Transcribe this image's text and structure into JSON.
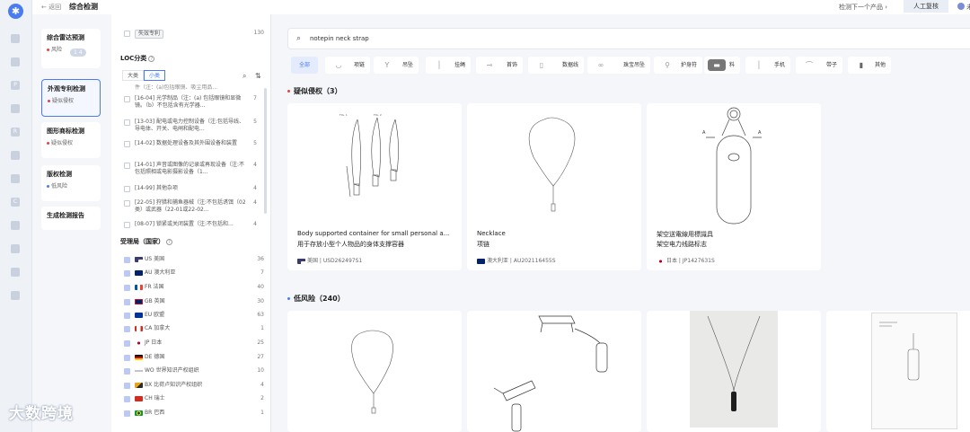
{
  "topbar": {
    "back": "← 返回",
    "title": "综合检测",
    "next_product": "检测下一个产品 ›",
    "manual": "人工复核",
    "user": "未"
  },
  "nav": [
    {
      "title": "综合雷达预测",
      "sub": "风险",
      "badge": "1 4"
    },
    {
      "title": "外观专利检测",
      "sub": "疑似侵权"
    },
    {
      "title": "图形商标检测",
      "sub": "疑似侵权"
    },
    {
      "title": "版权检测",
      "sub": "低风险"
    },
    {
      "title": "生成检测报告",
      "sub": ""
    }
  ],
  "filter": {
    "top_row": {
      "label": "失效专利",
      "count": "130"
    },
    "loc_title": "LOC分类",
    "tab_big": "大类",
    "tab_small": "小类",
    "loc_items": [
      {
        "text": "件（注：(a)包括眼镜、吸尘用品...",
        "count": ""
      },
      {
        "text": "[16-04] 光学制品（注：(a) 包括眼镜和显微镜。（b）不包括含有光学器...",
        "count": "7"
      },
      {
        "text": "[13-03] 配电或电力控制设备（注:包括导线、导电体、开关、电闸和配电...",
        "count": "5"
      },
      {
        "text": "[14-02] 数据处理设备及其外围设备和装置",
        "count": "5"
      },
      {
        "text": "[14-01] 声音或图像的记录或再现设备（注:不包括照相或电影摄影设备（1...",
        "count": "4"
      },
      {
        "text": "[14-99] 其他杂项",
        "count": "4"
      },
      {
        "text": "[22-05] 狩猎和捕鱼器械（注:不包括诱饵（02类）或武器（22-01或22-02...",
        "count": "4"
      },
      {
        "text": "[08-07] 锁紧或关闭装置（注:不包括和...",
        "count": "4"
      }
    ],
    "region_title": "受理局（国家）",
    "regions": [
      {
        "label": "US 美国",
        "count": "36",
        "flag": "us"
      },
      {
        "label": "AU 澳大利亚",
        "count": "7",
        "flag": "au"
      },
      {
        "label": "FR 法国",
        "count": "40",
        "flag": "fr"
      },
      {
        "label": "GB 英国",
        "count": "30",
        "flag": "gb"
      },
      {
        "label": "EU 欧盟",
        "count": "63",
        "flag": "eu"
      },
      {
        "label": "CA 加拿大",
        "count": "1",
        "flag": "ca"
      },
      {
        "label": "JP 日本",
        "count": "25",
        "flag": "jp"
      },
      {
        "label": "DE 德国",
        "count": "27",
        "flag": "de"
      },
      {
        "label": "WO 世界知识产权组织",
        "count": "10",
        "flag": "wo"
      },
      {
        "label": "BX 比荷卢知识产权组织",
        "count": "4",
        "flag": "bx"
      },
      {
        "label": "CH 瑞士",
        "count": "2",
        "flag": "ch"
      },
      {
        "label": "BR 巴西",
        "count": "1",
        "flag": "br"
      }
    ]
  },
  "search": {
    "value": "notepin neck strap"
  },
  "categories": [
    "全部",
    "项链",
    "吊坠",
    "挂绳",
    "首饰",
    "数据线",
    "珠宝吊坠",
    "护身符",
    "料",
    "手机",
    "带子",
    "其他"
  ],
  "group1": {
    "title": "疑似侵权（3）"
  },
  "group2": {
    "title": "低风险（240）"
  },
  "results": [
    {
      "title": "Body supported container for small personal a...",
      "sub": "用于存放小型个人物品的身体支撑容器",
      "country": "美国",
      "number": "USD262497S1"
    },
    {
      "title": "Necklace",
      "sub": "项链",
      "country": "澳大利亚",
      "number": "AU202116455S"
    },
    {
      "title": "架空送電線用標識具",
      "sub": "架空电力线路标志",
      "country": "日本",
      "number": "JP1427631S"
    }
  ],
  "watermark": "大数跨境",
  "colors": {
    "accent": "#4a7cf0",
    "risk": "#e04545"
  }
}
